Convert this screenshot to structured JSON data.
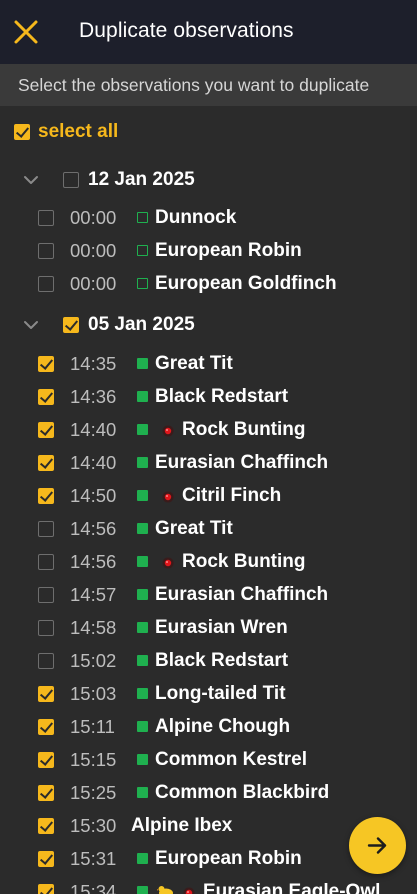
{
  "header": {
    "title": "Duplicate observations",
    "close_icon": "close-x-icon"
  },
  "subheader": {
    "text": "Select the observations you want to duplicate"
  },
  "select_all": {
    "label": "select all",
    "checked": true
  },
  "groups": [
    {
      "date": "12 Jan 2025",
      "checked": false,
      "expanded": true,
      "rows": [
        {
          "time": "00:00",
          "name": "Dunnock",
          "checked": false,
          "marker": "outline",
          "redpoint": false
        },
        {
          "time": "00:00",
          "name": "European Robin",
          "checked": false,
          "marker": "outline",
          "redpoint": false
        },
        {
          "time": "00:00",
          "name": "European Goldfinch",
          "checked": false,
          "marker": "outline",
          "redpoint": false
        }
      ]
    },
    {
      "date": "05 Jan 2025",
      "checked": true,
      "expanded": true,
      "rows": [
        {
          "time": "14:35",
          "name": "Great Tit",
          "checked": true,
          "marker": "filled",
          "redpoint": false
        },
        {
          "time": "14:36",
          "name": "Black Redstart",
          "checked": true,
          "marker": "filled",
          "redpoint": false
        },
        {
          "time": "14:40",
          "name": "Rock Bunting",
          "checked": true,
          "marker": "filled",
          "redpoint": true
        },
        {
          "time": "14:40",
          "name": "Eurasian Chaffinch",
          "checked": true,
          "marker": "filled",
          "redpoint": false
        },
        {
          "time": "14:50",
          "name": "Citril Finch",
          "checked": true,
          "marker": "filled",
          "redpoint": true
        },
        {
          "time": "14:56",
          "name": "Great Tit",
          "checked": false,
          "marker": "filled",
          "redpoint": false
        },
        {
          "time": "14:56",
          "name": "Rock Bunting",
          "checked": false,
          "marker": "filled",
          "redpoint": true
        },
        {
          "time": "14:57",
          "name": "Eurasian Chaffinch",
          "checked": false,
          "marker": "filled",
          "redpoint": false
        },
        {
          "time": "14:58",
          "name": "Eurasian Wren",
          "checked": false,
          "marker": "filled",
          "redpoint": false
        },
        {
          "time": "15:02",
          "name": "Black Redstart",
          "checked": false,
          "marker": "filled",
          "redpoint": false
        },
        {
          "time": "15:03",
          "name": "Long-tailed Tit",
          "checked": true,
          "marker": "filled",
          "redpoint": false
        },
        {
          "time": "15:11",
          "name": "Alpine Chough",
          "checked": true,
          "marker": "filled",
          "redpoint": false
        },
        {
          "time": "15:15",
          "name": "Common Kestrel",
          "checked": true,
          "marker": "filled",
          "redpoint": false
        },
        {
          "time": "15:25",
          "name": "Common Blackbird",
          "checked": true,
          "marker": "filled",
          "redpoint": false
        },
        {
          "time": "15:30",
          "name": "Alpine Ibex",
          "checked": true,
          "marker": "none",
          "redpoint": false
        },
        {
          "time": "15:31",
          "name": "European Robin",
          "checked": true,
          "marker": "filled",
          "redpoint": false
        },
        {
          "time": "15:34",
          "name": "Eurasian Eagle-Owl",
          "checked": true,
          "marker": "filled",
          "redpoint": true,
          "extra_icon": "yellow-bird-icon"
        }
      ]
    }
  ],
  "fab": {
    "icon": "arrow-right-icon",
    "color": "#f6c624"
  },
  "colors": {
    "accent": "#f6b81c",
    "header_bg": "#1d1f2b",
    "list_bg": "#2b2b2b",
    "marker_green": "#1fb04f",
    "red_point": "#e0161b"
  }
}
